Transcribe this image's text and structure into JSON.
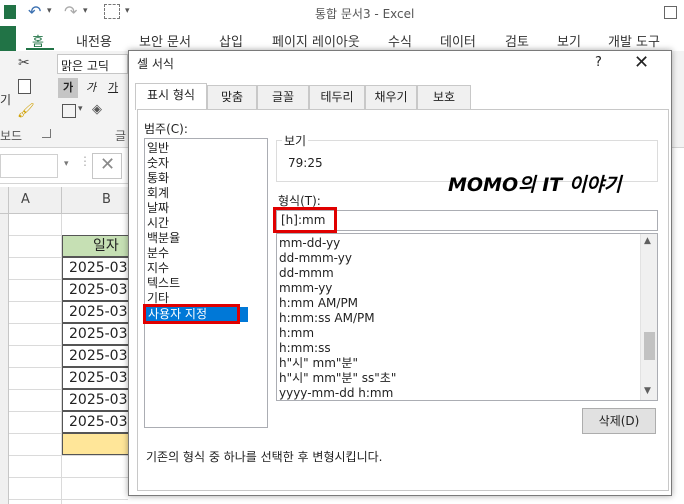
{
  "window": {
    "title": "통합 문서3 - Excel"
  },
  "ribbon": {
    "tabs": [
      "홈",
      "내전용",
      "보안 문서",
      "삽입",
      "페이지 레이아웃",
      "수식",
      "데이터",
      "검토",
      "보기",
      "개발 도구"
    ],
    "font_name": "맑은 고딕",
    "partial_label_left": "기",
    "partial_label_board": "보드",
    "partial_label_font": "글"
  },
  "sheet": {
    "column_a": "A",
    "column_b": "B",
    "header_cell": "일자",
    "dates": [
      "2025-03-",
      "2025-03-",
      "2025-03-",
      "2025-03-",
      "2025-03-",
      "2025-03-",
      "2025-03-",
      "2025-03-"
    ],
    "header_fill": "#c6e0b4",
    "highlight_fill": "#ffe699"
  },
  "dialog": {
    "title": "셀 서식",
    "help": "?",
    "close": "✕",
    "tabs": [
      "표시 형식",
      "맞춤",
      "글꼴",
      "테두리",
      "채우기",
      "보호"
    ],
    "category_label": "범주(C):",
    "categories": [
      "일반",
      "숫자",
      "통화",
      "회계",
      "날짜",
      "시간",
      "백분율",
      "분수",
      "지수",
      "텍스트",
      "기타",
      "사용자 지정"
    ],
    "selected_category": "사용자 지정",
    "preview_label": "보기",
    "preview_value": "79:25",
    "format_label": "형식(T):",
    "format_value": "[h]:mm",
    "format_list": [
      "mm-dd-yy",
      "dd-mmm-yy",
      "dd-mmm",
      "mmm-yy",
      "h:mm AM/PM",
      "h:mm:ss AM/PM",
      "h:mm",
      "h:mm:ss",
      "h\"시\" mm\"분\"",
      "h\"시\" mm\"분\" ss\"초\"",
      "yyyy-mm-dd h:mm"
    ],
    "delete_button": "삭제(D)",
    "description": "기존의 형식 중 하나를 선택한 후 변형시킵니다."
  },
  "watermark": {
    "text": "MOMO의 IT 이야기"
  },
  "colors": {
    "excel_green": "#217346",
    "selection_blue": "#0078d7",
    "annotation_red": "#e00000"
  }
}
